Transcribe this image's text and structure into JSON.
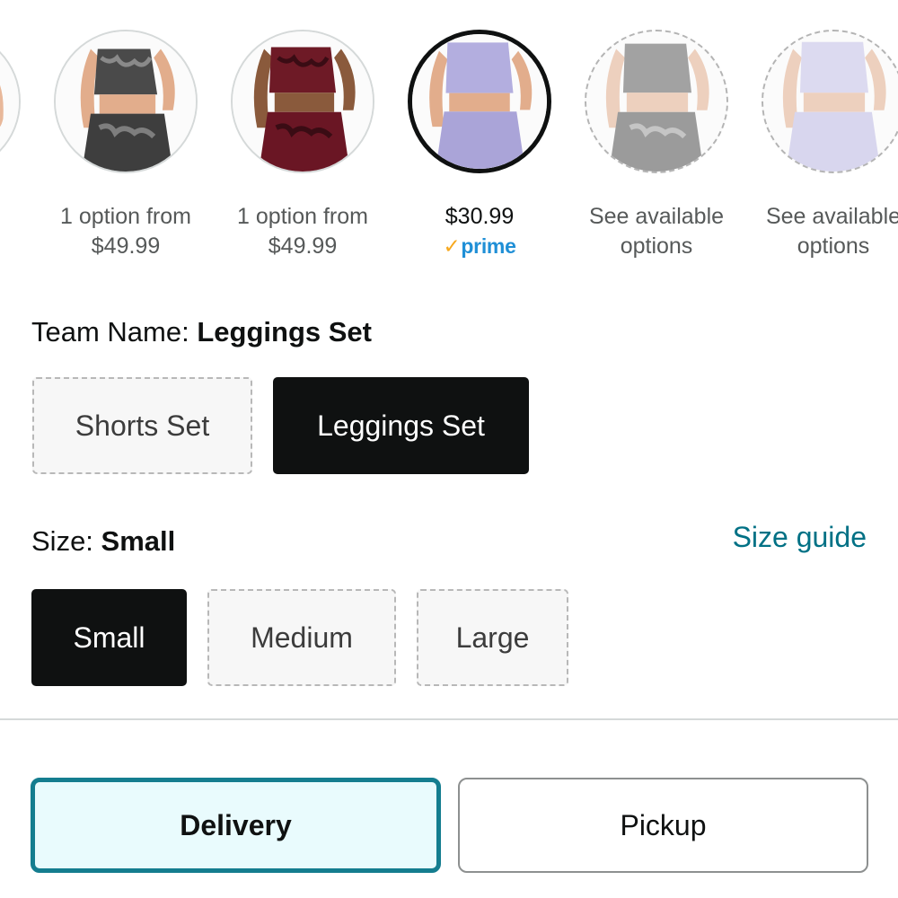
{
  "swatches": [
    {
      "line1": "",
      "line2": ""
    },
    {
      "line1": "1 option from",
      "line2": "$49.99"
    },
    {
      "line1": "1 option from",
      "line2": "$49.99"
    },
    {
      "line1": "$30.99",
      "prime": "prime",
      "prime_check": "✓"
    },
    {
      "line1": "See available",
      "line2": "options"
    },
    {
      "line1": "See available",
      "line2": "options"
    }
  ],
  "team_name": {
    "label": "Team Name:",
    "value": "Leggings Set",
    "options": [
      "Shorts Set",
      "Leggings Set"
    ],
    "selected": "Leggings Set"
  },
  "size": {
    "label": "Size:",
    "value": "Small",
    "guide_label": "Size guide",
    "options": [
      "Small",
      "Medium",
      "Large"
    ],
    "selected": "Small"
  },
  "fulfillment": {
    "tabs": [
      "Delivery",
      "Pickup"
    ],
    "selected": "Delivery"
  },
  "colors": {
    "teal_link": "#007185",
    "active_border": "#147d8f",
    "prime_blue": "#1f8fd6",
    "prime_check": "#f7a81d"
  }
}
